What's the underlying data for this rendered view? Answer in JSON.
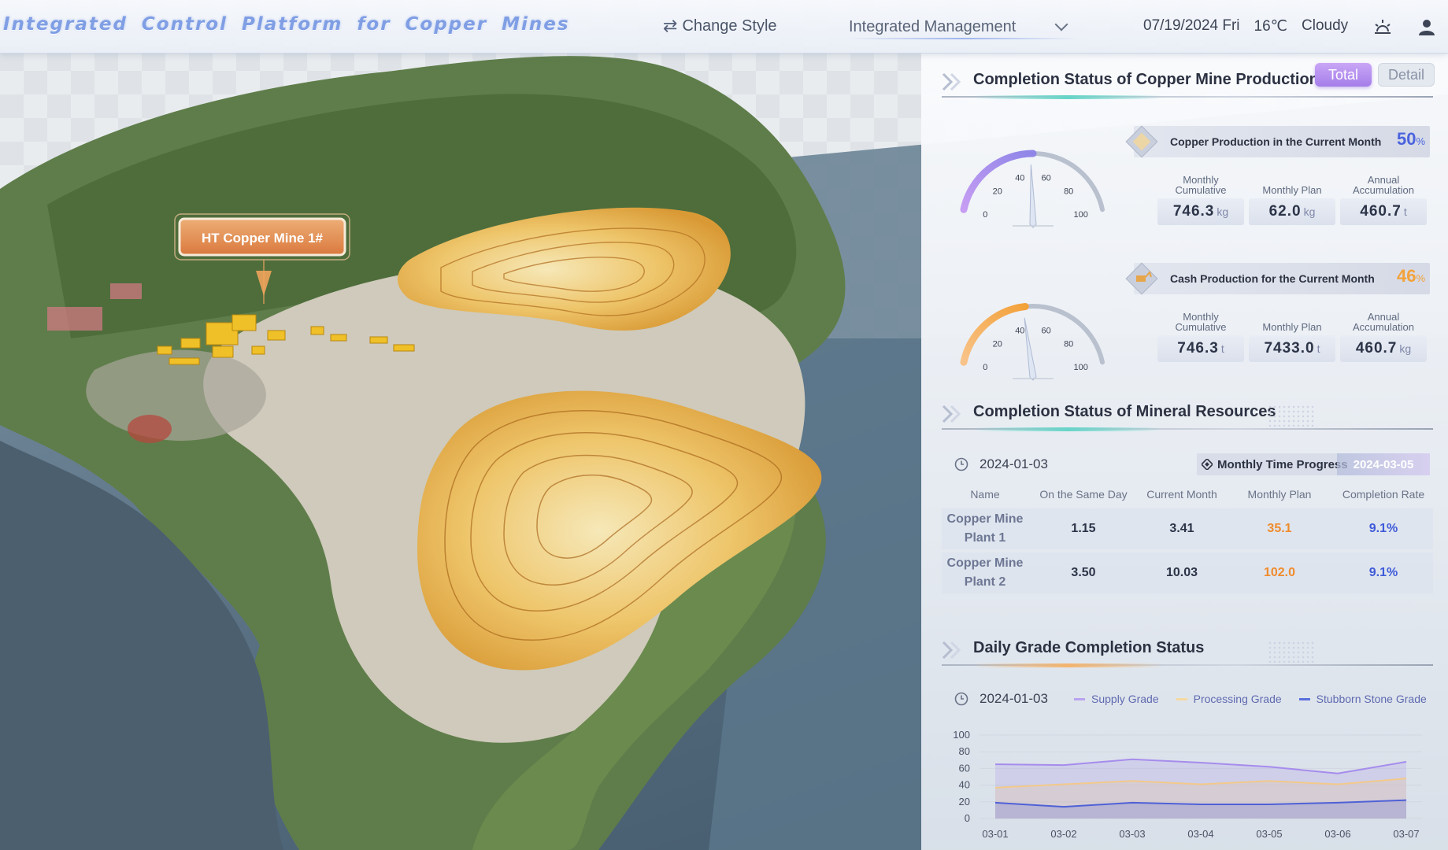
{
  "app": {
    "title": "Integrated Control Platform for Copper Mines"
  },
  "header": {
    "change_style_label": "Change Style",
    "management_label": "Integrated Management",
    "date": "07/19/2024 Fri",
    "temperature": "16℃",
    "weather": "Cloudy"
  },
  "map": {
    "marker_label": "HT Copper Mine 1#"
  },
  "production": {
    "title": "Completion Status of Copper Mine Production",
    "toggle_total": "Total",
    "toggle_detail": "Detail",
    "copper": {
      "label": "Copper Production in the Current Month",
      "percent": "50",
      "percent_value": 0.5,
      "gauge_ticks": [
        "0",
        "20",
        "40",
        "60",
        "80",
        "100"
      ],
      "stats": [
        {
          "caption": "Monthly Cumulative",
          "value": "746.3",
          "unit": "kg"
        },
        {
          "caption": "Monthly Plan",
          "value": "62.0",
          "unit": "kg"
        },
        {
          "caption": "Annual Accumulation",
          "value": "460.7",
          "unit": "t"
        }
      ]
    },
    "cash": {
      "label": "Cash Production for the Current Month",
      "percent": "46",
      "percent_value": 0.46,
      "gauge_ticks": [
        "0",
        "20",
        "40",
        "60",
        "80",
        "100"
      ],
      "stats": [
        {
          "caption": "Monthly Cumulative",
          "value": "746.3",
          "unit": "t"
        },
        {
          "caption": "Monthly Plan",
          "value": "7433.0",
          "unit": "t"
        },
        {
          "caption": "Annual Accumulation",
          "value": "460.7",
          "unit": "kg"
        }
      ]
    },
    "percent_unit": "%"
  },
  "minerals": {
    "title": "Completion Status of Mineral Resources",
    "date": "2024-01-03",
    "progress_label": "Monthly Time Progress",
    "progress_date": "2024-03-05",
    "columns": [
      "Name",
      "On the Same Day",
      "Current Month",
      "Monthly Plan",
      "Completion Rate"
    ],
    "rows": [
      {
        "name": "Copper Mine Plant 1",
        "same_day": "1.15",
        "month": "3.41",
        "plan": "35.1",
        "rate": "9.1%"
      },
      {
        "name": "Copper Mine Plant 2",
        "same_day": "3.50",
        "month": "10.03",
        "plan": "102.0",
        "rate": "9.1%"
      }
    ]
  },
  "grade": {
    "title": "Daily Grade Completion Status",
    "date": "2024-01-03",
    "legend": [
      {
        "name": "Supply Grade",
        "color": "#b9a3f0"
      },
      {
        "name": "Processing Grade",
        "color": "#f5d9a0"
      },
      {
        "name": "Stubborn Stone Grade",
        "color": "#5a6fdc"
      }
    ]
  },
  "chart_data": {
    "type": "area",
    "x": [
      "03-01",
      "03-02",
      "03-03",
      "03-04",
      "03-05",
      "03-06",
      "03-07"
    ],
    "ylim": [
      0,
      100
    ],
    "yticks": [
      "0",
      "20",
      "40",
      "60",
      "80",
      "100"
    ],
    "series": [
      {
        "name": "Supply Grade",
        "values": [
          65,
          64,
          71,
          67,
          62,
          54,
          68
        ],
        "color": "#a68cec"
      },
      {
        "name": "Processing Grade",
        "values": [
          37,
          41,
          45,
          41,
          45,
          41,
          48
        ],
        "color": "#f2c98a"
      },
      {
        "name": "Stubborn Stone Grade",
        "values": [
          19,
          14,
          19,
          17,
          17,
          19,
          22
        ],
        "color": "#4f61d6"
      }
    ]
  }
}
